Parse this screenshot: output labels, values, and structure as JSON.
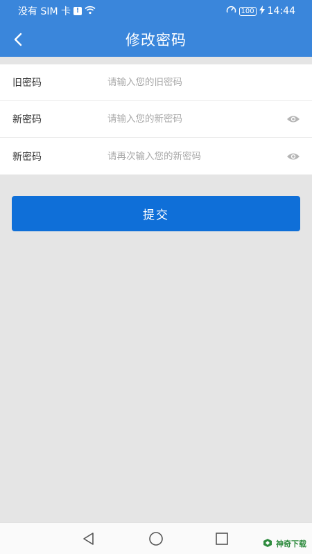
{
  "status_bar": {
    "carrier": "没有 SIM 卡",
    "sim_badge": "!",
    "battery": "100",
    "time": "14:44"
  },
  "header": {
    "title": "修改密码"
  },
  "form": {
    "rows": [
      {
        "label": "旧密码",
        "placeholder": "请输入您的旧密码",
        "value": "",
        "has_eye": false
      },
      {
        "label": "新密码",
        "placeholder": "请输入您的新密码",
        "value": "",
        "has_eye": true
      },
      {
        "label": "新密码",
        "placeholder": "请再次输入您的新密码",
        "value": "",
        "has_eye": true
      }
    ]
  },
  "submit_label": "提交",
  "watermark": {
    "text": "神奇下载",
    "icons": [
      "leaf-logo-icon"
    ]
  },
  "system_nav": {
    "icons": [
      "back-triangle-icon",
      "home-circle-icon",
      "recents-square-icon"
    ]
  },
  "colors": {
    "header": "#3a86db",
    "button": "#0f6fd8",
    "background": "#e5e5e5"
  }
}
